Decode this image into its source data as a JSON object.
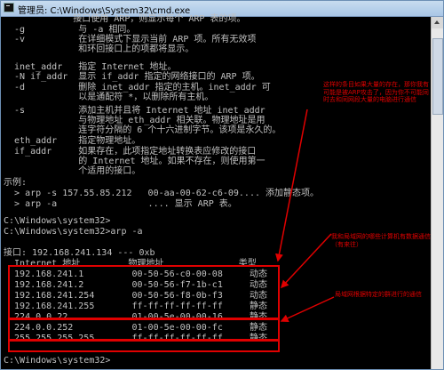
{
  "window": {
    "title": "管理员: C:\\Windows\\System32\\cmd.exe"
  },
  "console_lines": [
    "             接口使用 ARP，则显示每个 ARP 表的项。",
    "  -g          与 -a 相同。",
    "  -v          在详细模式下显示当前 ARP 项。所有无效项",
    "              和环回接口上的项都将显示。",
    "  inet_addr   指定 Internet 地址。",
    "  -N if_addr  显示 if_addr 指定的网络接口的 ARP 项。",
    "  -d          删除 inet_addr 指定的主机。inet_addr 可",
    "              以是通配符 *，以删除所有主机。",
    "  -s          添加主机并且将 Internet 地址 inet_addr",
    "              与物理地址 eth_addr 相关联。物理地址是用",
    "              连字符分隔的 6 个十六进制字节。该项是永久的。",
    "  eth_addr    指定物理地址。",
    "  if_addr     如果存在，此项指定地址转换表应修改的接口",
    "              的 Internet 地址。如果不存在，则使用第一",
    "              个适用的接口。",
    "示例:",
    "  > arp -s 157.55.85.212   00-aa-00-62-c6-09.... 添加静态项。",
    "  > arp -a                 .... 显示 ARP 表。",
    "",
    "C:\\Windows\\system32>",
    "C:\\Windows\\system32>arp -a",
    "",
    "接口: 192.168.241.134 --- 0xb",
    "  Internet 地址         物理地址              类型",
    "  192.168.241.1         00-50-56-c0-00-08     动态",
    "  192.168.241.2         00-50-56-f7-1b-c1     动态",
    "  192.168.241.254       00-50-56-f8-0b-f3     动态",
    "  192.168.241.255       ff-ff-ff-ff-ff-ff     静态",
    "  224.0.0.22            01-00-5e-00-00-16     静态",
    "  224.0.0.252           01-00-5e-00-00-fc     静态",
    "  255.255.255.255       ff-ff-ff-ff-ff-ff     静态",
    "",
    "C:\\Windows\\system32>"
  ],
  "annotations": {
    "top_right": "这样的条目如果大量的存在，那你我有可能是被ARP攻击了，因为你不可能同时去和同网段大量的电脑进行通信",
    "middle_right": "我和局域网的哪些计算机有数据通信（有来往）",
    "lower_right": "局域网根据特定的群进行的通信"
  },
  "colors": {
    "console_bg": "#000000",
    "console_text": "#c0c0c0",
    "annotation": "#e00000"
  }
}
